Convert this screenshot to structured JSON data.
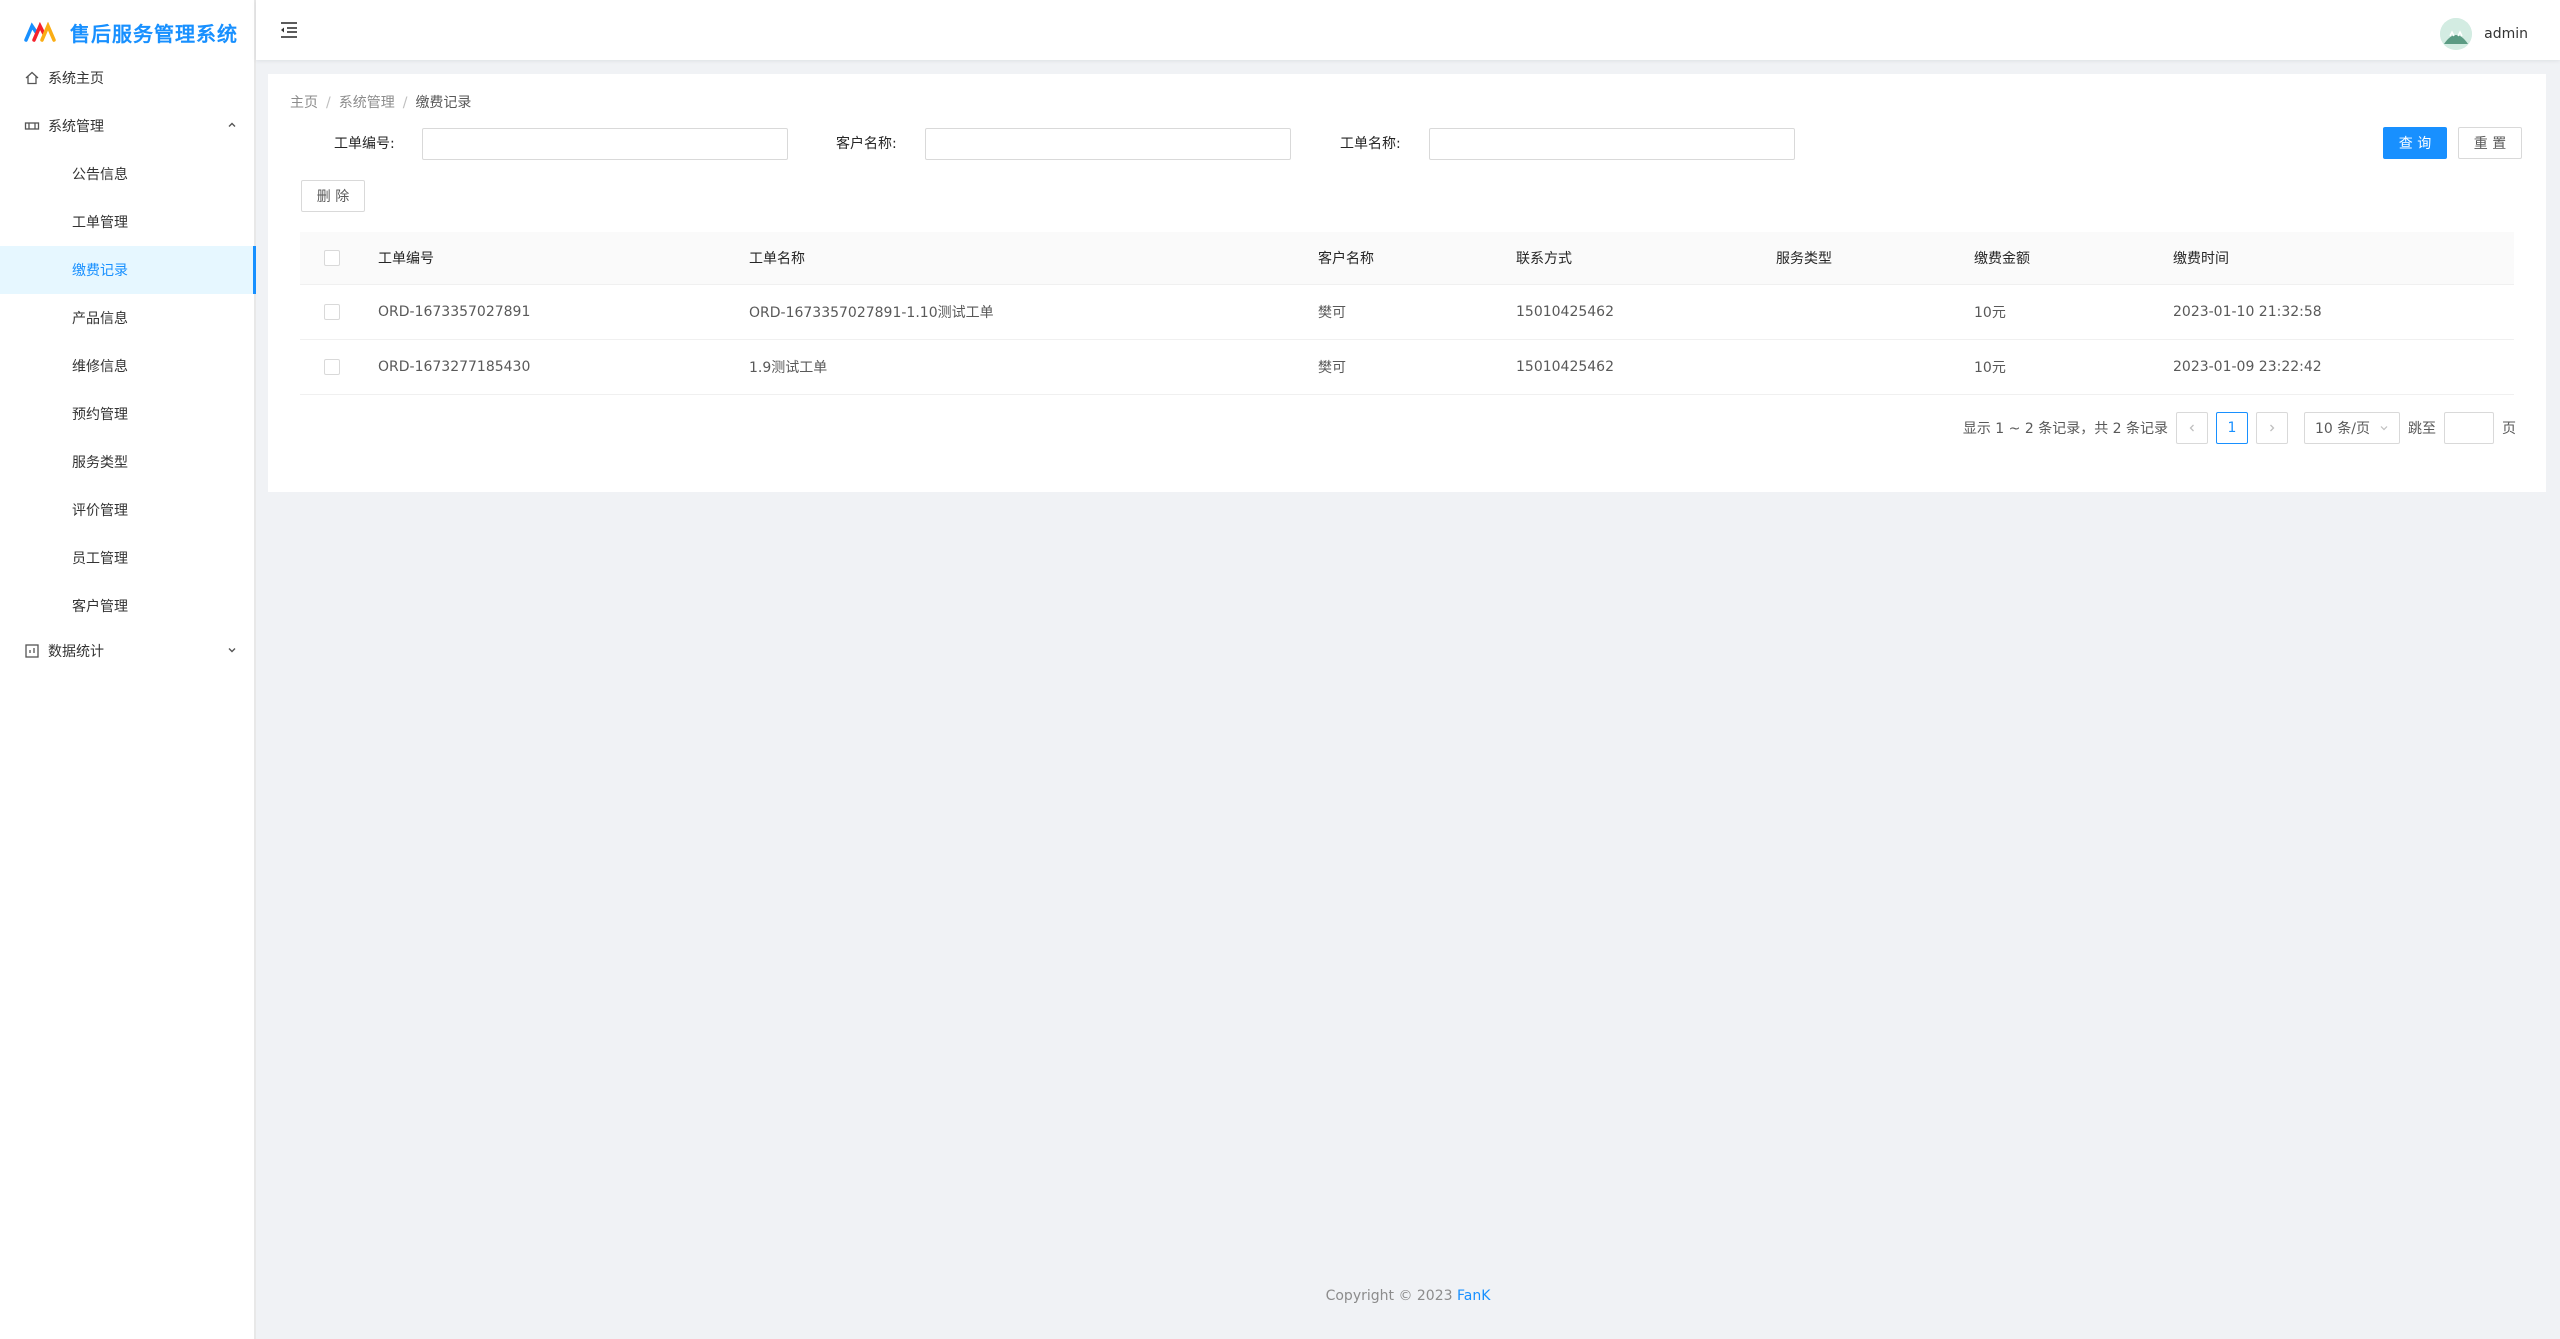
{
  "app": {
    "title": "售后服务管理系统"
  },
  "sidebar": {
    "home": "系统主页",
    "system": {
      "label": "系统管理",
      "items": [
        "公告信息",
        "工单管理",
        "缴费记录",
        "产品信息",
        "维修信息",
        "预约管理",
        "服务类型",
        "评价管理",
        "员工管理",
        "客户管理"
      ],
      "active_index": 2
    },
    "stats": "数据统计"
  },
  "header": {
    "username": "admin"
  },
  "breadcrumb": {
    "items": [
      "主页",
      "系统管理",
      "缴费记录"
    ]
  },
  "filters": {
    "order_no_label": "工单编号:",
    "customer_label": "客户名称:",
    "order_name_label": "工单名称:",
    "order_no_value": "",
    "customer_value": "",
    "order_name_value": "",
    "search_button": "查 询",
    "reset_button": "重 置"
  },
  "actions": {
    "delete_button": "删 除"
  },
  "table": {
    "columns": [
      "工单编号",
      "工单名称",
      "客户名称",
      "联系方式",
      "服务类型",
      "缴费金额",
      "缴费时间"
    ],
    "rows": [
      [
        "ORD-1673357027891",
        "ORD-1673357027891-1.10测试工单",
        "樊可",
        "15010425462",
        "",
        "10元",
        "2023-01-10 21:32:58"
      ],
      [
        "ORD-1673277185430",
        "1.9测试工单",
        "樊可",
        "15010425462",
        "",
        "10元",
        "2023-01-09 23:22:42"
      ]
    ]
  },
  "pagination": {
    "summary": "显示 1 ~ 2 条记录，共 2 条记录",
    "current_page": "1",
    "page_size": "10 条/页",
    "jump_label": "跳至",
    "page_label": "页"
  },
  "footer": {
    "copyright": "Copyright © 2023",
    "author": "FanK"
  },
  "colors": {
    "primary": "#1890ff",
    "active_bg": "#e6f7ff",
    "page_bg": "#f0f2f5"
  }
}
